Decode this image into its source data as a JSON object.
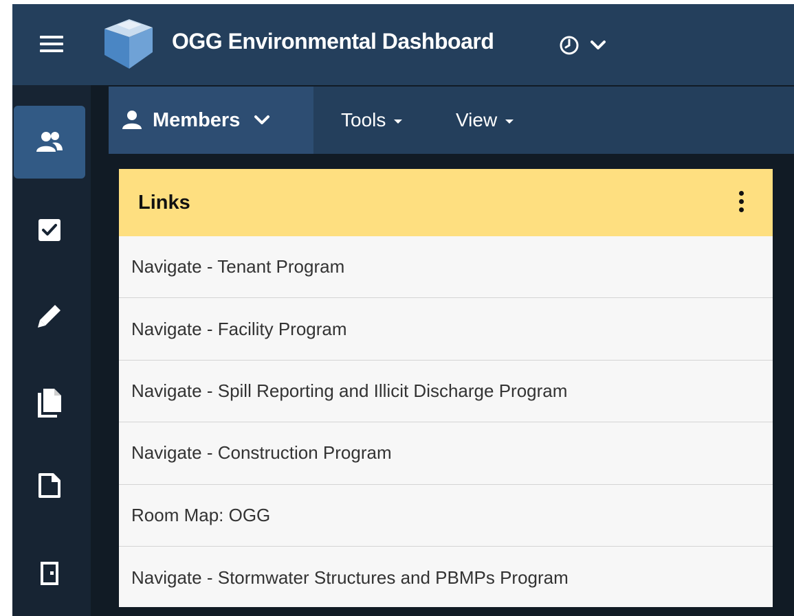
{
  "header": {
    "title": "OGG Environmental Dashboard",
    "icons": [
      "menu-icon",
      "logo",
      "clock-icon",
      "chevron-down-icon"
    ]
  },
  "rail": {
    "items": [
      {
        "icon": "people-icon",
        "active": true
      },
      {
        "icon": "checkbox-icon",
        "active": false
      },
      {
        "icon": "pencil-icon",
        "active": false
      },
      {
        "icon": "documents-icon",
        "active": false
      },
      {
        "icon": "page-icon",
        "active": false
      },
      {
        "icon": "door-icon",
        "active": false
      }
    ]
  },
  "toolbar": {
    "members_label": "Members",
    "tools_label": "Tools",
    "view_label": "View"
  },
  "card": {
    "title": "Links",
    "links": [
      "Navigate - Tenant Program",
      "Navigate - Facility Program",
      "Navigate - Spill Reporting and Illicit Discharge Program",
      "Navigate - Construction Program",
      "Room Map: OGG",
      "Navigate - Stormwater Structures and PBMPs Program"
    ]
  },
  "colors": {
    "header_bg": "#243f5c",
    "rail_bg": "#172433",
    "rail_active": "#325a85",
    "card_header": "#fedf80",
    "card_bg": "#f7f7f7"
  }
}
